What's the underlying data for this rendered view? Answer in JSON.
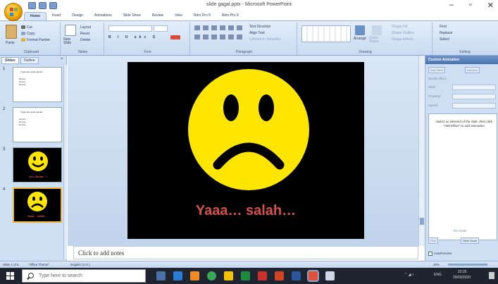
{
  "window": {
    "title": "slide gagal.pptx - Microsoft PowerPoint",
    "controls": [
      "–",
      "▫",
      "✕"
    ]
  },
  "ribbon": {
    "tabs": [
      "Home",
      "Insert",
      "Design",
      "Animations",
      "Slide Show",
      "Review",
      "View",
      "Nitro Pro 9",
      "Nitro Pro 9"
    ],
    "groups": {
      "clipboard": {
        "label": "Clipboard",
        "paste": "Paste",
        "cut": "Cut",
        "copy": "Copy",
        "format_painter": "Format Painter"
      },
      "slides": {
        "label": "Slides",
        "new_slide": "New Slide",
        "layout": "Layout",
        "reset": "Reset",
        "delete": "Delete"
      },
      "font": {
        "label": "Font"
      },
      "paragraph": {
        "label": "Paragraph",
        "text_direction": "Text Direction",
        "align_text": "Align Text",
        "convert": "Convert to SmartArt"
      },
      "drawing": {
        "label": "Drawing",
        "arrange": "Arrange",
        "quick_styles": "Quick Styles",
        "shape_fill": "Shape Fill",
        "shape_outline": "Shape Outline",
        "shape_effects": "Shape Effects"
      },
      "editing": {
        "label": "Editing",
        "find": "Find",
        "replace": "Replace",
        "select": "Select"
      }
    }
  },
  "left_panel": {
    "tabs": [
      "Slides",
      "Outline"
    ],
    "close": "×",
    "thumbs": [
      {
        "num": "1",
        "title": "Tugas tipe jarak pandai",
        "bullets": [
          "Rumus",
          "Rumus",
          "Rumus"
        ]
      },
      {
        "num": "2",
        "title": "Tugas tipe jarak pandai",
        "bullets": [
          "Rumus",
          "Rumus",
          "Rumus"
        ]
      },
      {
        "num": "3",
        "caption": "Yes, Benar…!"
      },
      {
        "num": "4",
        "caption": "Yaaa… salah…"
      }
    ]
  },
  "slide": {
    "caption": "Yaaa… salah…",
    "face_color": "#ffe600",
    "background": "#000000"
  },
  "notes": {
    "placeholder": "Click to add notes"
  },
  "task_pane": {
    "title": "Custom Animation",
    "add_effect": "Add Effect",
    "remove": "Remove",
    "modify_label": "Modify effect",
    "start_label": "Start:",
    "property_label": "Property:",
    "speed_label": "Speed:",
    "hint": "Select an element of the slide, then click \"Add Effect\" to add animation.",
    "reorder": "Re-Order",
    "play": "Play",
    "slide_show": "Slide Show",
    "autopreview": "AutoPreview"
  },
  "status_bar": {
    "slide_info": "Slide 4 of 5",
    "theme": "\"Office Theme\"",
    "language": "English (U.S.)",
    "zoom": "48%"
  },
  "taskbar": {
    "search_placeholder": "Type here to search",
    "tray_lang": "ENG",
    "time": "22:25",
    "date": "29/03/2020"
  }
}
